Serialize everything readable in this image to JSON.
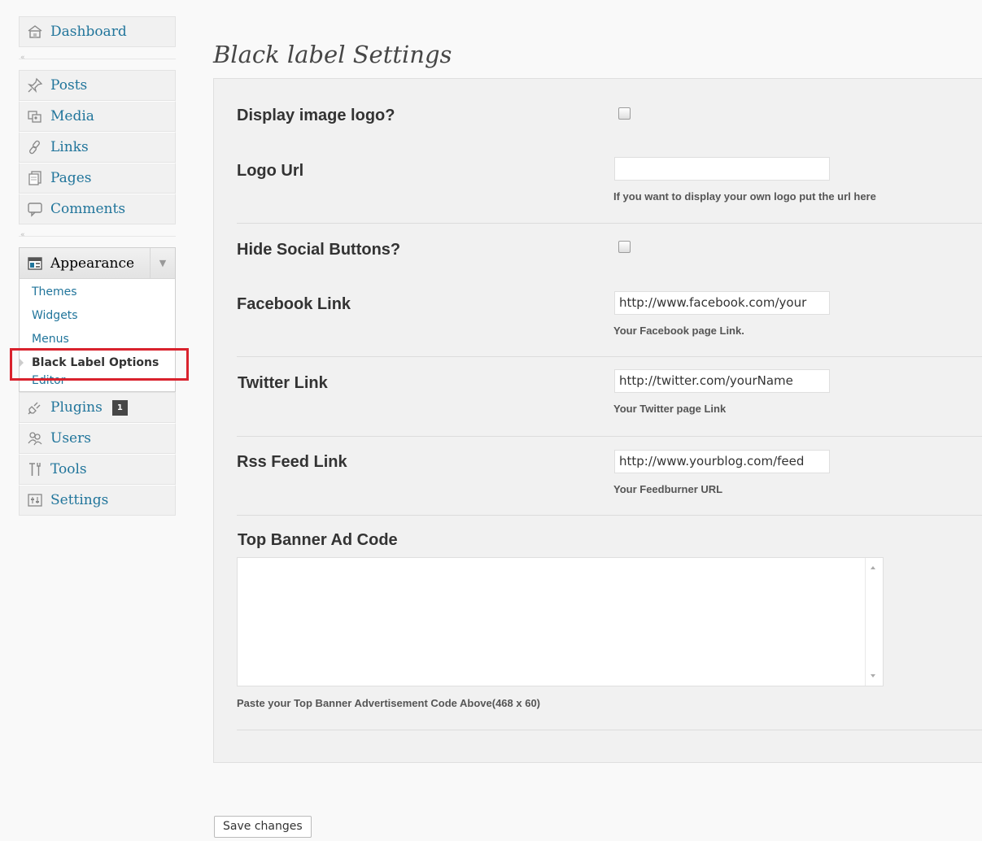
{
  "sidebar": {
    "dashboard": "Dashboard",
    "separator_glyph": "«",
    "items": [
      "Posts",
      "Media",
      "Links",
      "Pages",
      "Comments"
    ],
    "appearance": {
      "label": "Appearance",
      "toggle_glyph": "▼",
      "submenu": [
        "Themes",
        "Widgets",
        "Menus",
        "Black Label Options",
        "Editor"
      ],
      "current": "Black Label Options"
    },
    "plugins": {
      "label": "Plugins",
      "badge": "1"
    },
    "tail_items": [
      "Users",
      "Tools",
      "Settings"
    ]
  },
  "page": {
    "title": "Black label Settings"
  },
  "form": {
    "display_logo": {
      "label": "Display image logo?",
      "checked": false
    },
    "logo_url": {
      "label": "Logo Url",
      "value": "",
      "hint": "If you want to display your own logo put the url here"
    },
    "hide_social": {
      "label": "Hide Social Buttons?",
      "checked": false
    },
    "facebook": {
      "label": "Facebook Link",
      "value": "http://www.facebook.com/your",
      "hint": "Your Facebook page Link."
    },
    "twitter": {
      "label": "Twitter Link",
      "value": "http://twitter.com/yourName",
      "hint": "Your Twitter page Link"
    },
    "rss": {
      "label": "Rss Feed Link",
      "value": "http://www.yourblog.com/feed",
      "hint": "Your Feedburner URL"
    },
    "banner": {
      "label": "Top Banner Ad Code",
      "value": "",
      "hint": "Paste your Top Banner Advertisement Code Above(468 x 60)"
    }
  },
  "actions": {
    "save": "Save changes"
  },
  "colors": {
    "link": "#21759b",
    "highlight": "#d9222d",
    "panel": "#f1f1f1"
  }
}
